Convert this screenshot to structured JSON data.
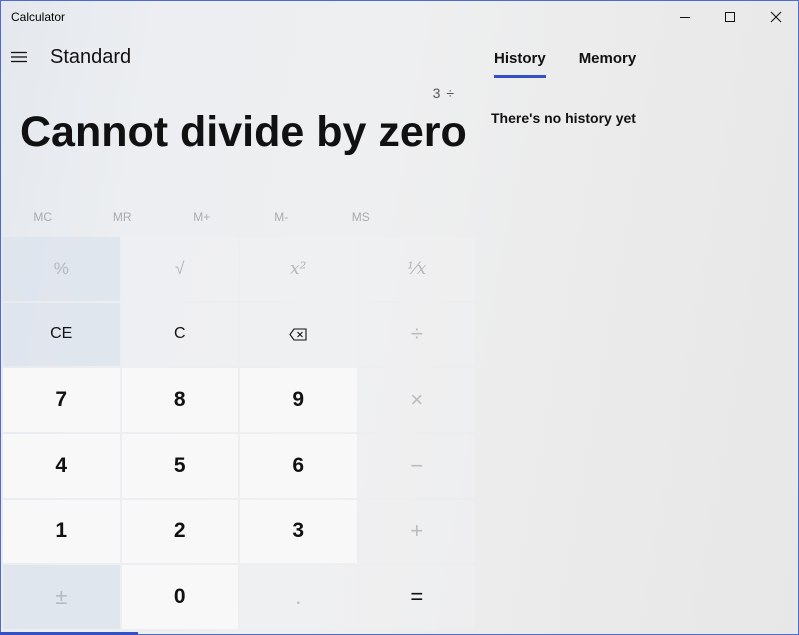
{
  "window": {
    "title": "Calculator"
  },
  "header": {
    "mode": "Standard"
  },
  "display": {
    "expression": "3 ÷",
    "result": "Cannot divide by zero"
  },
  "memory": [
    "MC",
    "MR",
    "M+",
    "M-",
    "MS"
  ],
  "keys": {
    "percent": "%",
    "sqrt": "√",
    "square": "x²",
    "reciprocal": "¹⁄x",
    "ce": "CE",
    "c": "C",
    "divide": "÷",
    "seven": "7",
    "eight": "8",
    "nine": "9",
    "multiply": "×",
    "four": "4",
    "five": "5",
    "six": "6",
    "minus": "−",
    "one": "1",
    "two": "2",
    "three": "3",
    "plus": "+",
    "negate": "±",
    "zero": "0",
    "decimal": ".",
    "equals": "="
  },
  "tabs": {
    "history": "History",
    "memory": "Memory"
  },
  "history": {
    "empty_message": "There's no history yet"
  },
  "colors": {
    "accent": "#3350c4"
  }
}
